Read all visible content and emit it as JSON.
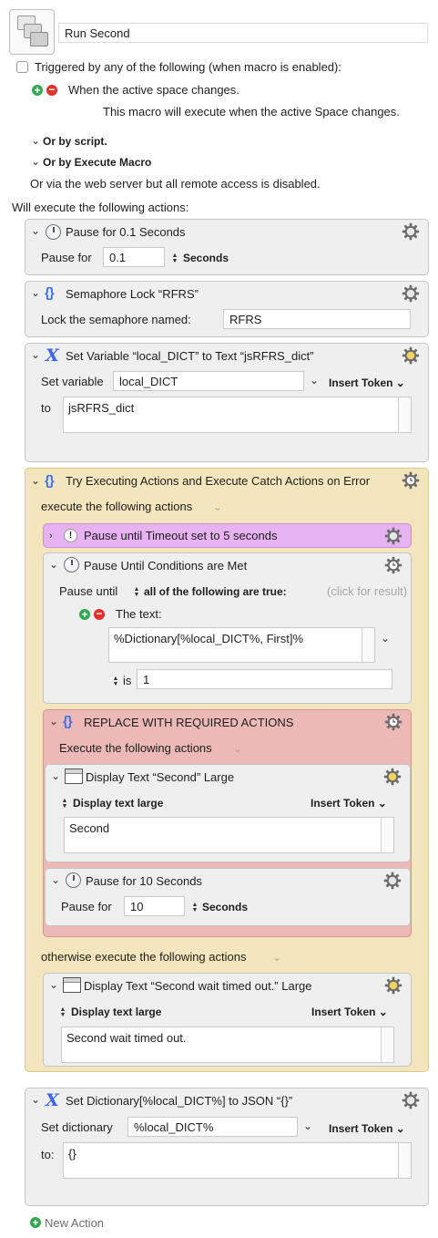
{
  "macro": {
    "name": "Run Second",
    "trigger_label": "Triggered by any of the following (when macro is enabled):",
    "trigger_item": "When the active space changes.",
    "trigger_desc": "This macro will execute when the active Space changes.",
    "or_script": "Or by script.",
    "or_execute": "Or by Execute Macro",
    "web_server": "Or via the web server but all remote access is disabled.",
    "will_execute": "Will execute the following actions:"
  },
  "actions": {
    "pause1": {
      "title": "Pause for 0.1 Seconds",
      "label": "Pause for",
      "value": "0.1",
      "unit": "Seconds"
    },
    "sema": {
      "title": "Semaphore Lock “RFRS”",
      "label": "Lock the semaphore named:",
      "value": "RFRS"
    },
    "setvar": {
      "title": "Set Variable “local_DICT” to Text “jsRFRS_dict”",
      "label": "Set variable",
      "var": "local_DICT",
      "insert_token": "Insert Token",
      "to_label": "to",
      "to_value": "jsRFRS_dict"
    },
    "try": {
      "title": "Try Executing Actions and Execute Catch Actions on Error",
      "execute_label": "execute the following actions",
      "timeout": {
        "title": "Pause until Timeout set to 5 seconds"
      },
      "pause_until": {
        "title": "Pause Until Conditions are Met",
        "label": "Pause until",
        "mode": "all of the following are true:",
        "click_result": "(click for result)",
        "cond_label": "The text:",
        "text": "%Dictionary[%local_DICT%, First]%",
        "is_label": "is",
        "is_value": "1"
      },
      "replace": {
        "title": "REPLACE WITH REQUIRED ACTIONS",
        "execute_label": "Execute the following actions",
        "display": {
          "title": "Display Text “Second” Large",
          "mode": "Display text large",
          "insert_token": "Insert Token",
          "text": "Second"
        },
        "pause": {
          "title": "Pause for 10 Seconds",
          "label": "Pause for",
          "value": "10",
          "unit": "Seconds"
        }
      },
      "otherwise_label": "otherwise execute the following actions",
      "display2": {
        "title": "Display Text “Second wait timed out.” Large",
        "mode": "Display text large",
        "insert_token": "Insert Token",
        "text": "Second wait timed out."
      }
    },
    "setdict": {
      "title": "Set Dictionary[%local_DICT%] to JSON “{}”",
      "label": "Set dictionary",
      "value": "%local_DICT%",
      "insert_token": "Insert Token",
      "to_label": "to:",
      "to_value": "{}"
    }
  },
  "new_action": "New Action",
  "colors": {
    "try_bg": "#f3e6bd",
    "timeout_bg": "#e6b2f0",
    "replace_bg": "#ecb9b7",
    "card_bg": "#efefef",
    "accent": "#3f6ff0"
  },
  "icons": [
    "macro-group-icon",
    "clock-icon",
    "braces-icon",
    "variable-x-icon",
    "window-icon",
    "gear-icon",
    "gear-timer-icon",
    "exclamation-icon",
    "plus-icon",
    "minus-icon"
  ]
}
